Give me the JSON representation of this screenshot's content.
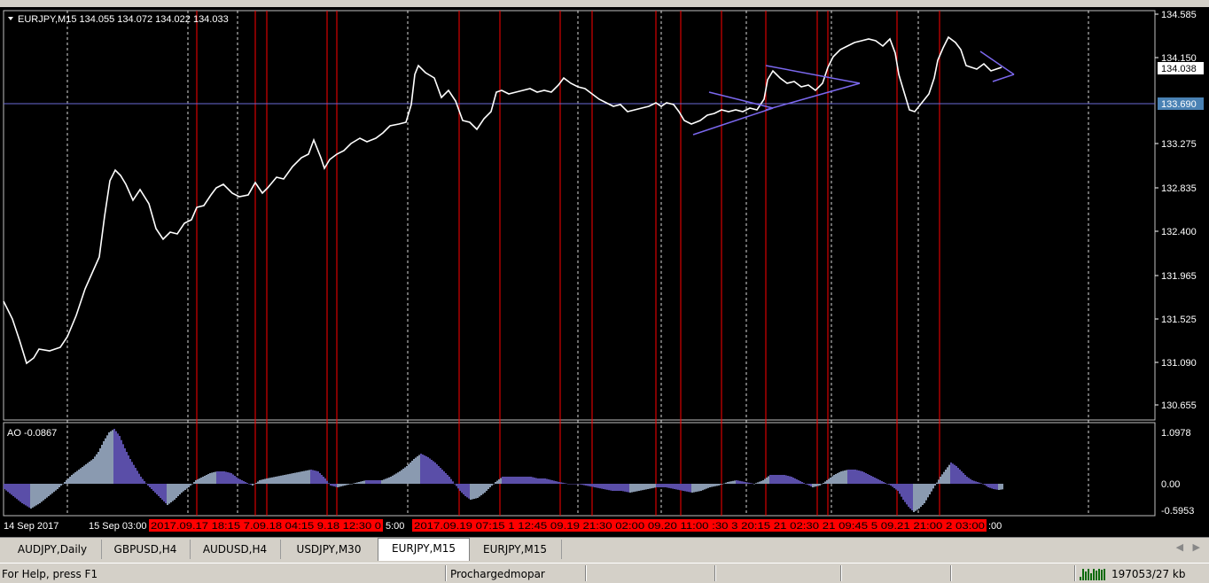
{
  "window": {
    "symbol_info": "EURJPY,M15  134.055 134.072 134.022 134.033"
  },
  "price_axis": {
    "ticks": [
      "134.585",
      "134.150",
      "133.275",
      "132.835",
      "132.400",
      "131.965",
      "131.525",
      "131.090",
      "130.655"
    ],
    "current_price": "134.038",
    "horizontal_line_price": "133.690"
  },
  "indicator": {
    "label": "AO -0.0867",
    "ticks": [
      "1.0978",
      "0.00",
      "-0.5953"
    ]
  },
  "time_axis": {
    "labels": [
      "14 Sep 2017",
      "15 Sep 03:00"
    ],
    "red_labels_1": "2017.09.17 18:15 7.09.18 04:15 9.18 12:30 0",
    "mid_label": "5:00",
    "red_labels_2": "2017.09.19 07:15 1 12:45 09.19 21:30 02:00 09.20 11:00 :30 3 20:15 21 02:30 21 09:45 5 09.21 21:00 2 03:00",
    "end_label": ":00"
  },
  "tabs": [
    {
      "label": "AUDJPY,Daily",
      "active": false
    },
    {
      "label": "GBPUSD,H4",
      "active": false
    },
    {
      "label": "AUDUSD,H4",
      "active": false
    },
    {
      "label": "USDJPY,M30",
      "active": false
    },
    {
      "label": "EURJPY,M15",
      "active": true
    },
    {
      "label": "EURJPY,M15",
      "active": false
    }
  ],
  "status": {
    "help": "For Help, press F1",
    "profile": "Prochargedmopar",
    "traffic": "197053/27 kb"
  },
  "colors": {
    "background": "#000000",
    "price_line": "#ffffff",
    "vertical_red": "#ff0000",
    "triangle": "#7b68ee",
    "horizontal_line": "#6a6ad6",
    "ao_positive": "#8a9ab0",
    "ao_negative": "#5a4ea8",
    "label_red_bg": "#ff0000",
    "current_price_bg": "#ffffff",
    "hline_label_bg": "#4a82b4"
  }
}
